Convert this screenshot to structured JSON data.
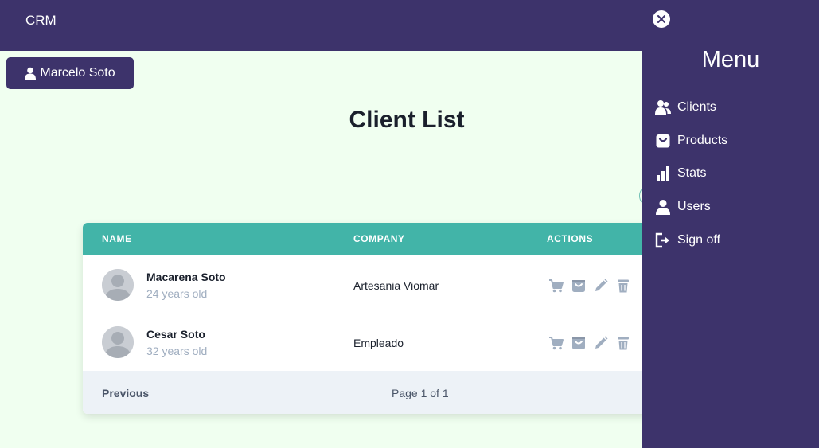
{
  "header": {
    "brand": "CRM"
  },
  "user_button": {
    "label": "Marcelo Soto",
    "icon": "user-icon"
  },
  "page": {
    "title": "Client List"
  },
  "table": {
    "columns": [
      "NAME",
      "COMPANY",
      "ACTIONS"
    ],
    "rows": [
      {
        "name": "Macarena Soto",
        "age": "24 years old",
        "company": "Artesania Viomar"
      },
      {
        "name": "Cesar Soto",
        "age": "32 years old",
        "company": "Empleado"
      }
    ],
    "row_action_icons": [
      "cart-icon",
      "shopping-bag-icon",
      "pencil-icon",
      "trash-icon"
    ],
    "pagination": {
      "previous": "Previous",
      "page_info": "Page 1 of 1"
    }
  },
  "drawer": {
    "title": "Menu",
    "close_icon": "close-icon",
    "items": [
      {
        "label": "Clients",
        "icon": "users-icon"
      },
      {
        "label": "Products",
        "icon": "shopping-bag-icon"
      },
      {
        "label": "Stats",
        "icon": "bar-chart-icon"
      },
      {
        "label": "Users",
        "icon": "user-icon"
      },
      {
        "label": "Sign off",
        "icon": "sign-out-icon"
      }
    ]
  },
  "colors": {
    "primary": "#3d336b",
    "table_header": "#42b4a8",
    "page_background": "#f0fff0",
    "footer_background": "#edf2f7",
    "action_icon": "#a0aec0"
  }
}
